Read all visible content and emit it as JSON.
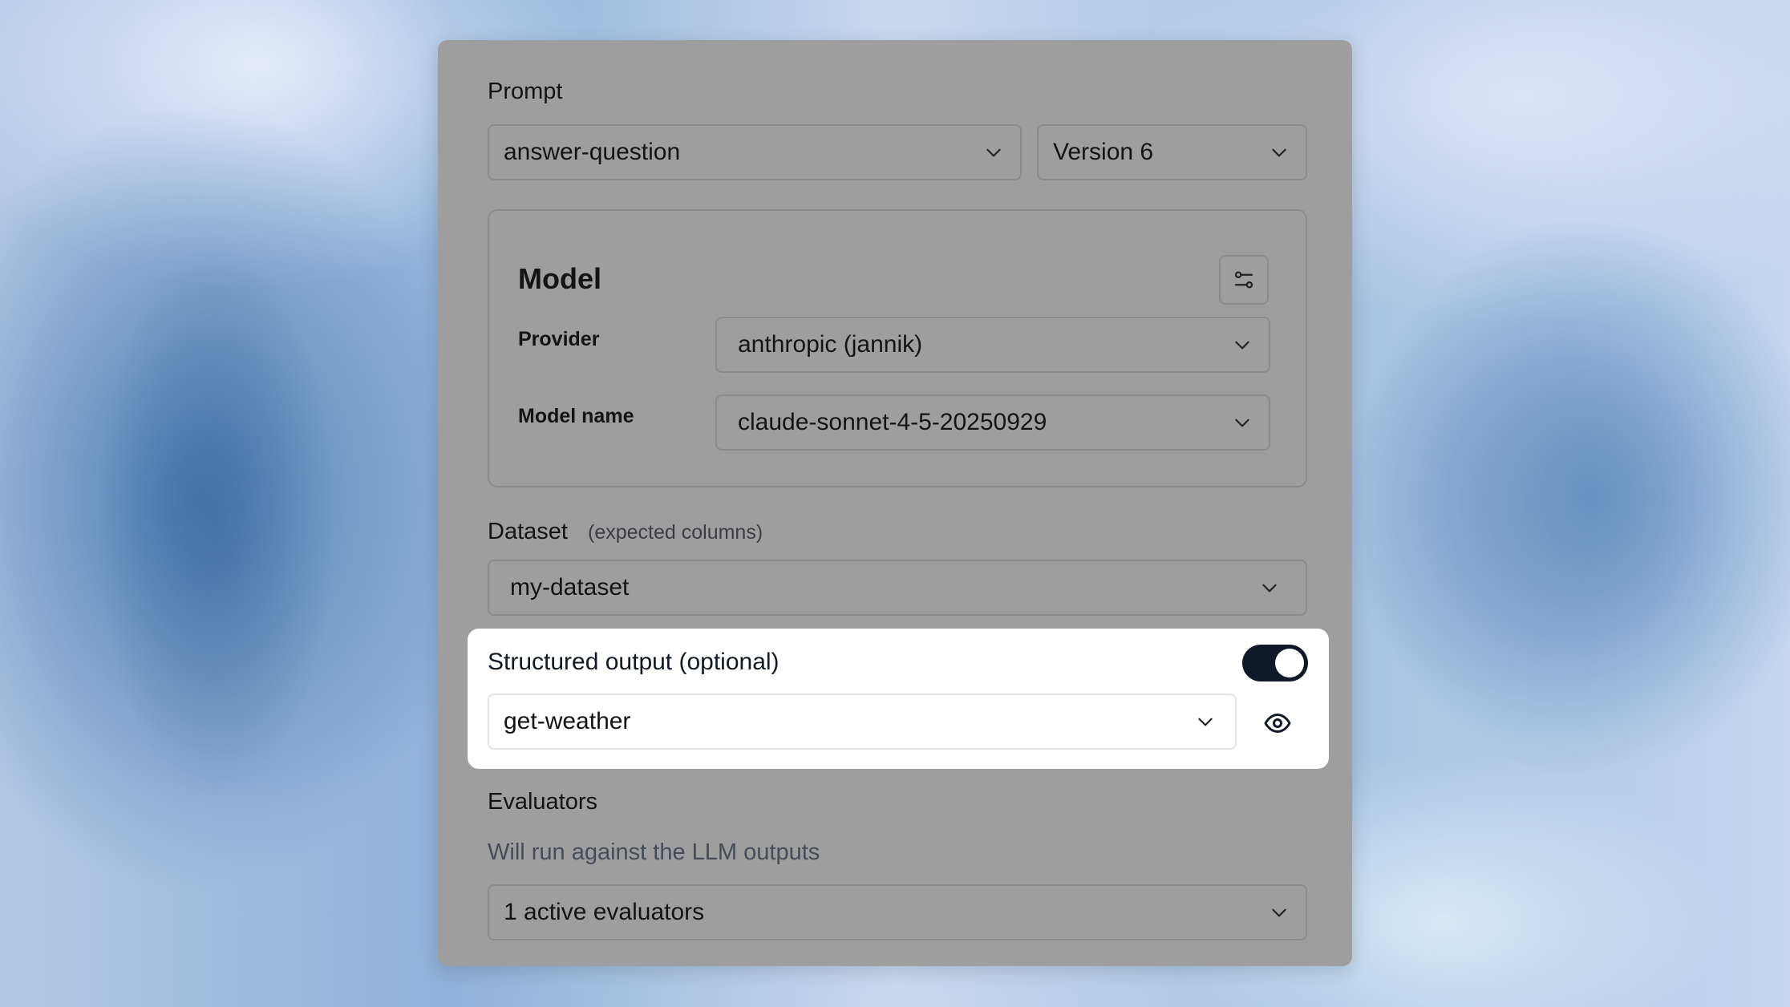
{
  "prompt": {
    "label": "Prompt",
    "name_value": "answer-question",
    "version_value": "Version 6"
  },
  "model": {
    "title": "Model",
    "settings_icon": "sliders-icon",
    "provider_label": "Provider",
    "provider_value": "anthropic (jannik)",
    "model_name_label": "Model name",
    "model_name_value": "claude-sonnet-4-5-20250929"
  },
  "dataset": {
    "label": "Dataset",
    "hint": "(expected columns)",
    "value": "my-dataset"
  },
  "structured_output": {
    "label": "Structured output (optional)",
    "enabled": true,
    "schema_value": "get-weather",
    "preview_icon": "eye-icon"
  },
  "evaluators": {
    "label": "Evaluators",
    "description": "Will run against the LLM outputs",
    "value": "1 active evaluators"
  },
  "colors": {
    "panel_bg": "#9e9e9e",
    "toggle_on": "#111827",
    "highlight_bg": "#ffffff"
  }
}
